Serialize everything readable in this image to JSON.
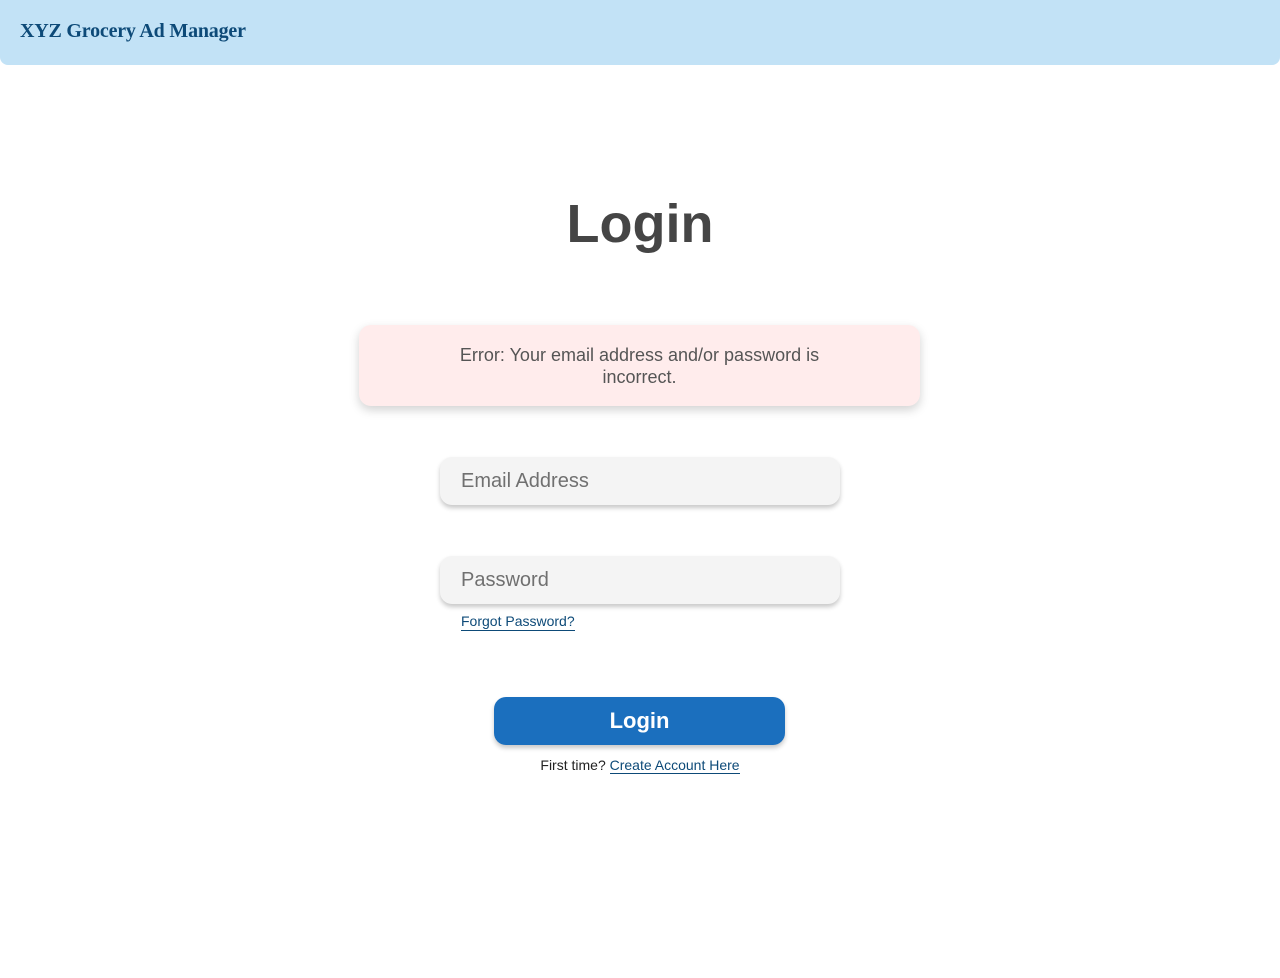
{
  "header": {
    "app_title": "XYZ Grocery Ad Manager"
  },
  "page": {
    "title": "Login"
  },
  "error": {
    "message": "Error: Your email address and/or password is incorrect."
  },
  "form": {
    "email_placeholder": "Email Address",
    "password_placeholder": "Password",
    "forgot_password_label": "Forgot Password?",
    "login_button_label": "Login"
  },
  "signup": {
    "prompt": "First time?",
    "link_label": "Create Account Here"
  },
  "colors": {
    "header_bg": "#c2e2f6",
    "brand_text": "#0d4a78",
    "error_bg": "#ffecec",
    "primary_button": "#1b6fbe"
  }
}
